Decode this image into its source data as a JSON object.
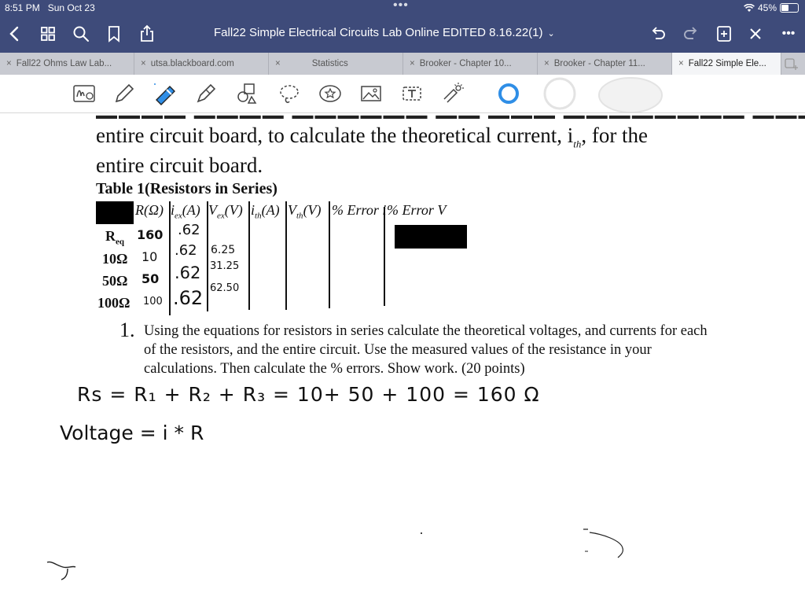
{
  "status": {
    "time": "8:51 PM",
    "date": "Sun Oct 23",
    "battery": "45%",
    "battery_level": 0.45
  },
  "nav": {
    "doc_title": "Fall22 Simple Electrical Circuits Lab Online EDITED 8.16.22(1)"
  },
  "tabs": [
    {
      "label": "Fall22 Ohms Law Lab...",
      "active": false
    },
    {
      "label": "utsa.blackboard.com",
      "active": false
    },
    {
      "label": "Statistics",
      "active": false
    },
    {
      "label": "Brooker - Chapter 10...",
      "active": false
    },
    {
      "label": "Brooker - Chapter 11...",
      "active": false
    },
    {
      "label": "Fall22 Simple Ele...",
      "active": true
    }
  ],
  "colors": {
    "bar": "#3e4b7a",
    "pen_blue": "#2f8ee6",
    "tab_bg": "#c8cad1"
  },
  "document": {
    "line1": "entire circuit board, to calculate the theoretical current, i",
    "line1_sub": "th",
    "line1_end": ", for the",
    "line2": "entire circuit board.",
    "table_title": "Table 1(Resistors in Series)",
    "headers": [
      "R(Ω)",
      "i",
      "ex",
      "(A)",
      "V",
      "ex",
      "(V)",
      "i",
      "th",
      "(A)",
      "V",
      "th",
      "(V)",
      "% Error i",
      "% Error V"
    ],
    "rows": [
      {
        "label": "R",
        "sub": "eq",
        "r": "160",
        "i": ".62",
        "v": ""
      },
      {
        "label": "10Ω",
        "sub": "",
        "r": "10",
        "i": ".62",
        "v": "6.25"
      },
      {
        "label": "50Ω",
        "sub": "",
        "r": "50",
        "i": ".62",
        "v": "31.25"
      },
      {
        "label": "100Ω",
        "sub": "",
        "r": "100",
        "i": ".62",
        "v": "62.50"
      }
    ],
    "item_number": "1.",
    "item_text": "Using the equations for resistors in series calculate the theoretical voltages, and currents for each of the resistors, and the entire circuit. Use the measured values of the resistance in your calculations. Then calculate the % errors. Show work. (20 points)",
    "hand_eq1": "Rs = R₁ + R₂ + R₃  =  10+ 50 + 100  = 160 Ω",
    "hand_eq2": "Voltage = i * R"
  }
}
